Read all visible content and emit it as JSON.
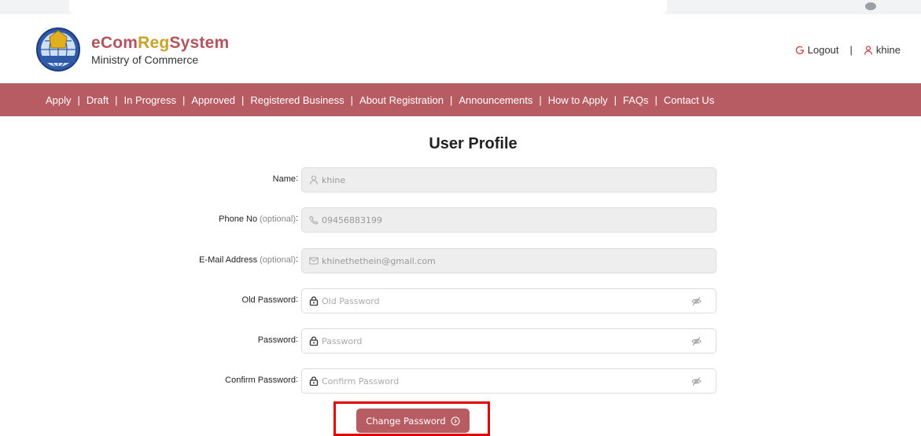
{
  "header": {
    "brand": {
      "part1": "eCom",
      "part2": "Reg",
      "part3": "System",
      "subtitle": "Ministry of Commerce"
    },
    "logout_label": "Logout",
    "separator": "|",
    "user_label": "khine"
  },
  "nav": {
    "items": [
      "Apply",
      "Draft",
      "In Progress",
      "Approved",
      "Registered Business",
      "About Registration",
      "Announcements",
      "How to Apply",
      "FAQs",
      "Contact Us"
    ],
    "separator": "|"
  },
  "page_title": "User Profile",
  "form": {
    "colon": ":",
    "name": {
      "label": "Name",
      "value": "khine"
    },
    "phone": {
      "label": "Phone No",
      "optional": "(optional)",
      "value": "09456883199"
    },
    "email": {
      "label": "E-Mail Address",
      "optional": "(optional)",
      "value": "khinethethein@gmail.com"
    },
    "old_password": {
      "label": "Old Password",
      "placeholder": "Old Password"
    },
    "password": {
      "label": "Password",
      "placeholder": "Password"
    },
    "confirm_password": {
      "label": "Confirm Password",
      "placeholder": "Confirm Password"
    },
    "submit_label": "Change Password"
  },
  "colors": {
    "brand_primary": "#b85c63",
    "brand_gold": "#c9a227",
    "highlight": "#e00000"
  }
}
